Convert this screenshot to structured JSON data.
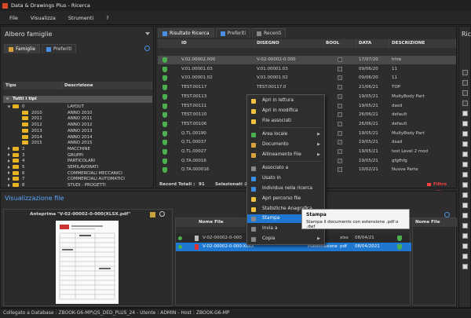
{
  "window": {
    "title": "Data & Drawings Plus - Ricerca"
  },
  "menu": [
    "File",
    "Visualizza",
    "Strumenti",
    "?"
  ],
  "tree_panel": {
    "title": "Albero famiglie",
    "tabs": [
      "Famiglie",
      "Preferiti"
    ],
    "columns": [
      "Tipo",
      "Descrizione"
    ],
    "root": "Tutti i tipi",
    "rows": [
      {
        "tipo": "0",
        "desc": "LAYOUT"
      },
      {
        "tipo": "2010",
        "desc": "ANNO 2010"
      },
      {
        "tipo": "2011",
        "desc": "ANNO 2011"
      },
      {
        "tipo": "2012",
        "desc": "ANNO 2012"
      },
      {
        "tipo": "2013",
        "desc": "ANNO 2013"
      },
      {
        "tipo": "2014",
        "desc": "ANNO 2014"
      },
      {
        "tipo": "2015",
        "desc": "ANNO 2015"
      },
      {
        "tipo": "2",
        "desc": "MACCHINE"
      },
      {
        "tipo": "3",
        "desc": "GRUPPI"
      },
      {
        "tipo": "4",
        "desc": "PARTICOLARI"
      },
      {
        "tipo": "5",
        "desc": "SEMILAVORATI"
      },
      {
        "tipo": "6",
        "desc": "COMMERCIALI MECCANICI"
      },
      {
        "tipo": "7",
        "desc": "COMMERCIALI AUTOMATICI"
      },
      {
        "tipo": "8",
        "desc": "STUDI - PROGETTI"
      }
    ]
  },
  "results_panel": {
    "tabs": [
      "Risultato Ricerca",
      "Preferiti",
      "Recenti"
    ],
    "columns": [
      "ID",
      "DISEGNO",
      "BOOL",
      "DATA",
      "DESCRIZIONE"
    ],
    "rows": [
      {
        "id": "V.02.00002.000",
        "disegno": "V-02-00002-0.000",
        "data": "17/07/20",
        "desc": "trtre"
      },
      {
        "id": "V.01.00001.03",
        "disegno": "V.01.00001.03",
        "data": "09/06/20",
        "desc": "11"
      },
      {
        "id": "V.01.00001.02",
        "disegno": "V.01.00001.02",
        "data": "09/06/20",
        "desc": "11"
      },
      {
        "id": "TEST.00117",
        "disegno": "TEST.00117.0",
        "data": "21/06/21",
        "desc": "TOP"
      },
      {
        "id": "TEST.00113",
        "disegno": "",
        "data": "19/05/21",
        "desc": "MultyBody Part"
      },
      {
        "id": "TEST.00111",
        "disegno": "",
        "data": "19/05/21",
        "desc": "dasd"
      },
      {
        "id": "TEST.00110",
        "disegno": "",
        "data": "26/06/21",
        "desc": "default"
      },
      {
        "id": "TEST.00106",
        "disegno": "",
        "data": "26/06/21",
        "desc": "default"
      },
      {
        "id": "Q.TL.00190",
        "disegno": "",
        "data": "19/05/21",
        "desc": "MultyBody Part"
      },
      {
        "id": "Q.TL.00037",
        "disegno": "",
        "data": "19/05/21",
        "desc": "dsad"
      },
      {
        "id": "Q.TL.00027",
        "disegno": "",
        "data": "19/05/21",
        "desc": "test Level 2 mod"
      },
      {
        "id": "Q.TA.00016",
        "disegno": "",
        "data": "19/05/21",
        "desc": "gfgfhfg"
      },
      {
        "id": "Q.TA.000016",
        "disegno": "",
        "data": "10/02/21",
        "desc": "Nuova Parte"
      }
    ],
    "footer_total_label": "Record Totali :",
    "footer_total": "91",
    "footer_selected_label": "Selezionati :",
    "footer_selected": "1",
    "footer_filter": "Filtro attivo"
  },
  "context_menu": {
    "items": [
      {
        "label": "Apri in lettura",
        "arrow": false
      },
      {
        "label": "Apri in modifica",
        "arrow": false
      },
      {
        "label": "File associati",
        "arrow": false
      },
      {
        "label": "Area locale",
        "arrow": true
      },
      {
        "label": "Documento",
        "arrow": true
      },
      {
        "label": "Allineamento File",
        "arrow": true
      },
      {
        "label": "Associato a",
        "arrow": false
      },
      {
        "label": "Usato in",
        "arrow": false
      },
      {
        "label": "Individua nella ricerca",
        "arrow": false
      },
      {
        "label": "Apri percorso file",
        "arrow": false
      },
      {
        "label": "Statistiche Anagrafica",
        "arrow": false
      },
      {
        "label": "Stampa",
        "arrow": false
      },
      {
        "label": "Invia a",
        "arrow": true
      },
      {
        "label": "Copia",
        "arrow": true
      }
    ]
  },
  "tooltip": {
    "title": "Stampa",
    "body": "Stampa il documento con estensione .pdf o .dwf"
  },
  "preview_panel": {
    "title": "Visualizzazione file",
    "preview_label": "Anteprima \"V-02-00002-0-000(XLSX.pdf\"",
    "files_header": "Nome File",
    "files_header2": "Nome File",
    "file_rows": [
      {
        "name": "V-02-00002-0-000",
        "ext": "xlsx",
        "date": "08/04/21",
        "type": ""
      },
      {
        "name": "V-02-00002-0-000-XLSX",
        "ext": "pdf",
        "date": "08/04/2021",
        "type": "Pubblicazione"
      }
    ]
  },
  "right_panel": {
    "title": "Ric"
  },
  "statusbar": {
    "text": "Collegato a Database : ZBOOK-G6-MP\\QS_DED_PLUS_24  -  Utente : ADMIN  -  Host : ZBOOK-G6-MP"
  },
  "colors": {
    "accent": "#1e78d2",
    "folder": "#e6b422",
    "shield": "#4caf50",
    "filter": "#ff4040"
  }
}
